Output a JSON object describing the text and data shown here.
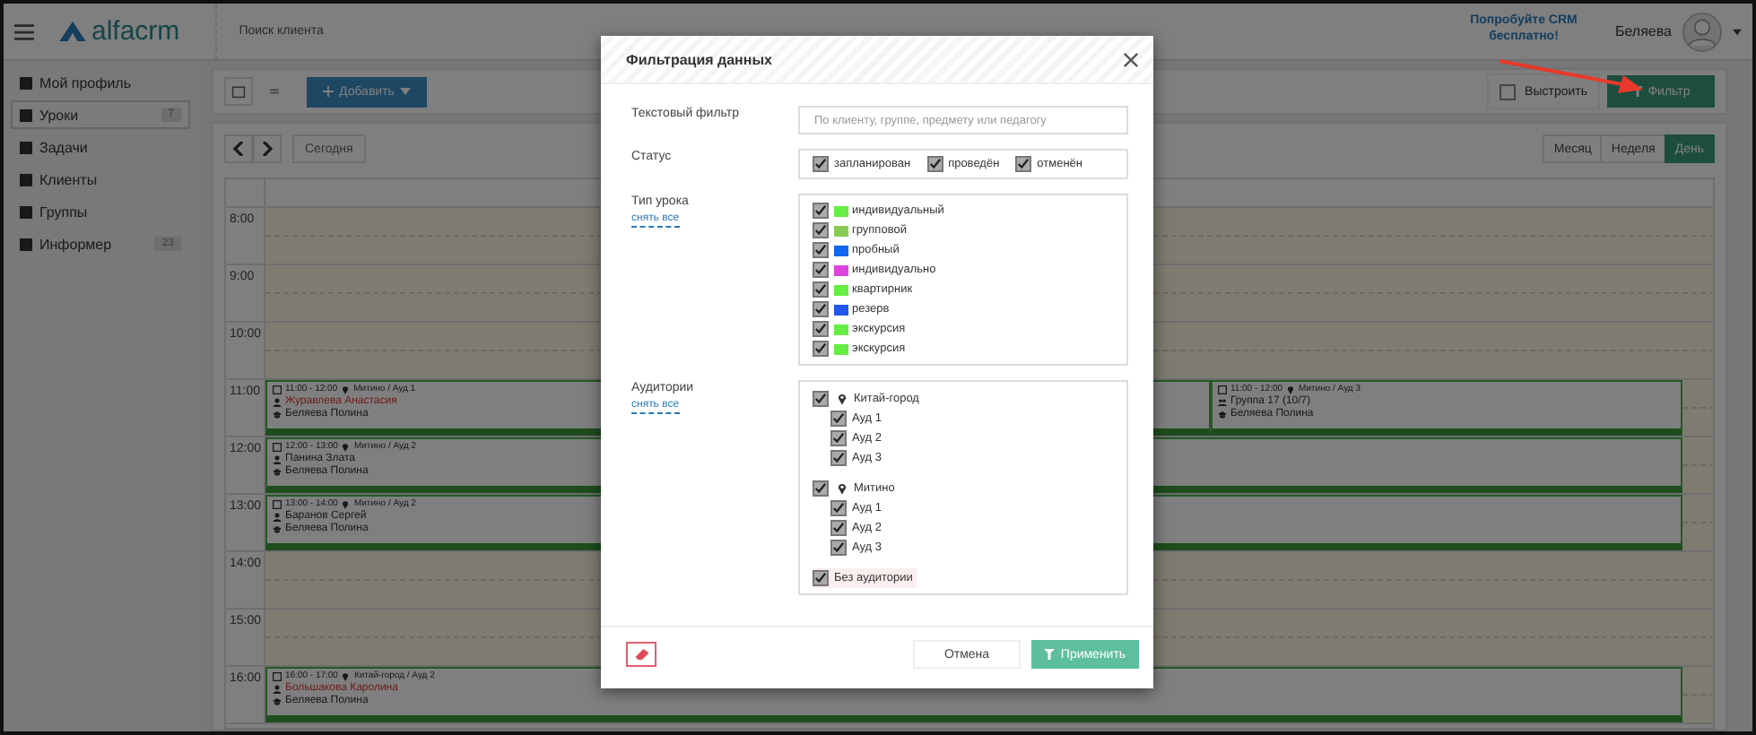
{
  "header": {
    "logo": "alfacrm",
    "search_placeholder": "Поиск клиента",
    "promo": "Попробуйте CRM бесплатно!",
    "user_name": "Беляева"
  },
  "sidebar": {
    "items": [
      {
        "label": "Мой профиль",
        "selected": false
      },
      {
        "label": "Уроки",
        "badge": "7",
        "selected": true
      },
      {
        "label": "Задачи",
        "selected": false
      },
      {
        "label": "Клиенты",
        "selected": false
      },
      {
        "label": "Группы",
        "selected": false
      },
      {
        "label": "Информер",
        "badge": "23",
        "selected": false
      }
    ]
  },
  "toolbar": {
    "add_button": "Добавить",
    "arrange": {
      "label": "Выстроить",
      "checked": false
    },
    "filter_button": "Фильтр"
  },
  "calendar": {
    "today_button": "Сегодня",
    "views": [
      {
        "label": "Месяц",
        "selected": false
      },
      {
        "label": "Неделя",
        "selected": false
      },
      {
        "label": "День",
        "selected": true
      }
    ],
    "hours": [
      {
        "time": "8:00"
      },
      {
        "time": "9:00"
      },
      {
        "time": "10:00"
      },
      {
        "time": "11:00",
        "events": [
          {
            "kind": "individual",
            "time": "11:00 - 12:00",
            "place": "Митино / Ауд 1",
            "client": "Журавлева Анастасия",
            "client_alert": true,
            "teacher": "Беляева Полина"
          },
          {
            "kind": "group",
            "time": "11:00 - 12:00",
            "place": "Митино / Ауд 3",
            "client": "Группа 17 (10/7)",
            "client_alert": false,
            "teacher": "Беляева Полина"
          }
        ]
      },
      {
        "time": "12:00",
        "events": [
          {
            "kind": "individual",
            "time": "12:00 - 13:00",
            "place": "Митино / Ауд 2",
            "client": "Панина Злата",
            "client_alert": false,
            "teacher": "Беляева Полина"
          }
        ]
      },
      {
        "time": "13:00",
        "events": [
          {
            "kind": "individual",
            "time": "13:00 - 14:00",
            "place": "Митино / Ауд 2",
            "client": "Баранов Сергей",
            "client_alert": false,
            "teacher": "Беляева Полина"
          }
        ]
      },
      {
        "time": "14:00"
      },
      {
        "time": "15:00"
      },
      {
        "time": "16:00",
        "events": [
          {
            "kind": "individual",
            "time": "16:00 - 17:00",
            "place": "Китай-город / Ауд 2",
            "client": "Большакова Каролина",
            "client_alert": true,
            "teacher": "Беляева Полина"
          }
        ]
      }
    ]
  },
  "modal": {
    "title": "Фильтрация данных",
    "text_filter": {
      "label": "Текстовый фильтр",
      "placeholder": "По клиенту, группе, предмету или педагогу"
    },
    "status": {
      "label": "Статус",
      "options": [
        {
          "label": "запланирован",
          "checked": true
        },
        {
          "label": "проведён",
          "checked": true
        },
        {
          "label": "отменён",
          "checked": true
        }
      ]
    },
    "lesson_types": {
      "label": "Тип урока",
      "clear_link": "снять все",
      "items": [
        {
          "label": "индивидуальный",
          "checked": true,
          "color": "#66ee44"
        },
        {
          "label": "групповой",
          "checked": true,
          "color": "#88cc55"
        },
        {
          "label": "пробный",
          "checked": true,
          "color": "#1166ee"
        },
        {
          "label": "индивидуально",
          "checked": true,
          "color": "#dd44dd"
        },
        {
          "label": "квартирник",
          "checked": true,
          "color": "#66ee44"
        },
        {
          "label": "резерв",
          "checked": true,
          "color": "#2255ee"
        },
        {
          "label": "экскурсия",
          "checked": true,
          "color": "#66ee44"
        },
        {
          "label": "экскурсия",
          "checked": true,
          "color": "#66ee44"
        }
      ]
    },
    "rooms": {
      "label": "Аудитории",
      "clear_link": "снять все",
      "locations": [
        {
          "name": "Китай-город",
          "checked": true,
          "children": [
            {
              "label": "Ауд 1",
              "checked": true
            },
            {
              "label": "Ауд 2",
              "checked": true
            },
            {
              "label": "Ауд 3",
              "checked": true
            }
          ]
        },
        {
          "name": "Митино",
          "checked": true,
          "children": [
            {
              "label": "Ауд 1",
              "checked": true
            },
            {
              "label": "Ауд 2",
              "checked": true
            },
            {
              "label": "Ауд 3",
              "checked": true
            }
          ]
        }
      ],
      "no_room": {
        "label": "Без аудитории",
        "checked": true
      }
    },
    "cancel_button": "Отмена",
    "apply_button": "Применить"
  }
}
